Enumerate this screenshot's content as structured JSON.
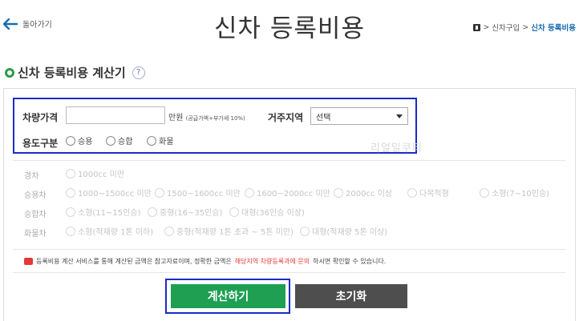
{
  "header": {
    "back_label": "돌아가기",
    "title": "신차 등록비용",
    "breadcrumb": [
      "신차구입",
      "신차 등록비용"
    ]
  },
  "section": {
    "title": "신차 등록비용 계산기",
    "help": "?"
  },
  "form": {
    "price_label": "차량가격",
    "price_value": "",
    "unit": "만원",
    "unit_note": "(공급가액+부가세 10%)",
    "region_label": "거주지역",
    "region_selected": "선택",
    "usage_label": "용도구분",
    "usage_options": [
      "승용",
      "승합",
      "화물"
    ]
  },
  "watermark": "리얼밀쿠티",
  "categories": [
    {
      "label": "경차",
      "options": [
        "1000cc 미만"
      ]
    },
    {
      "label": "승용차",
      "options": [
        "1000~1500cc 미만",
        "1500~1600cc 미만",
        "1600~2000cc 미만",
        "2000cc 이상",
        "다목적형",
        "소형(7~10인승)"
      ]
    },
    {
      "label": "승합차",
      "options": [
        "소형(11~15인승)",
        "중형(16~35인승)",
        "대형(36인승 이상)"
      ]
    },
    {
      "label": "화물차",
      "options": [
        "소형(적재량 1톤 이하)",
        "중형(적재량 1톤 초과 ~ 5톤 미만)",
        "대형(적재량 5톤 이상)"
      ]
    }
  ],
  "notice": {
    "prefix": "등록비용 계산 서비스를 통해 계산된 금액은 참고자료이며, 정확한 금액은 ",
    "highlight": "해당지역 차량등록과에 문의",
    "suffix": "하시면 확인할 수 있습니다."
  },
  "buttons": {
    "calculate": "계산하기",
    "reset": "초기화"
  },
  "colors": {
    "primary_green": "#1e9f52",
    "reset_gray": "#4e4e4e",
    "highlight_blue": "#1a2cc4",
    "link_blue": "#1a6bb0",
    "notice_red": "#e53935"
  }
}
